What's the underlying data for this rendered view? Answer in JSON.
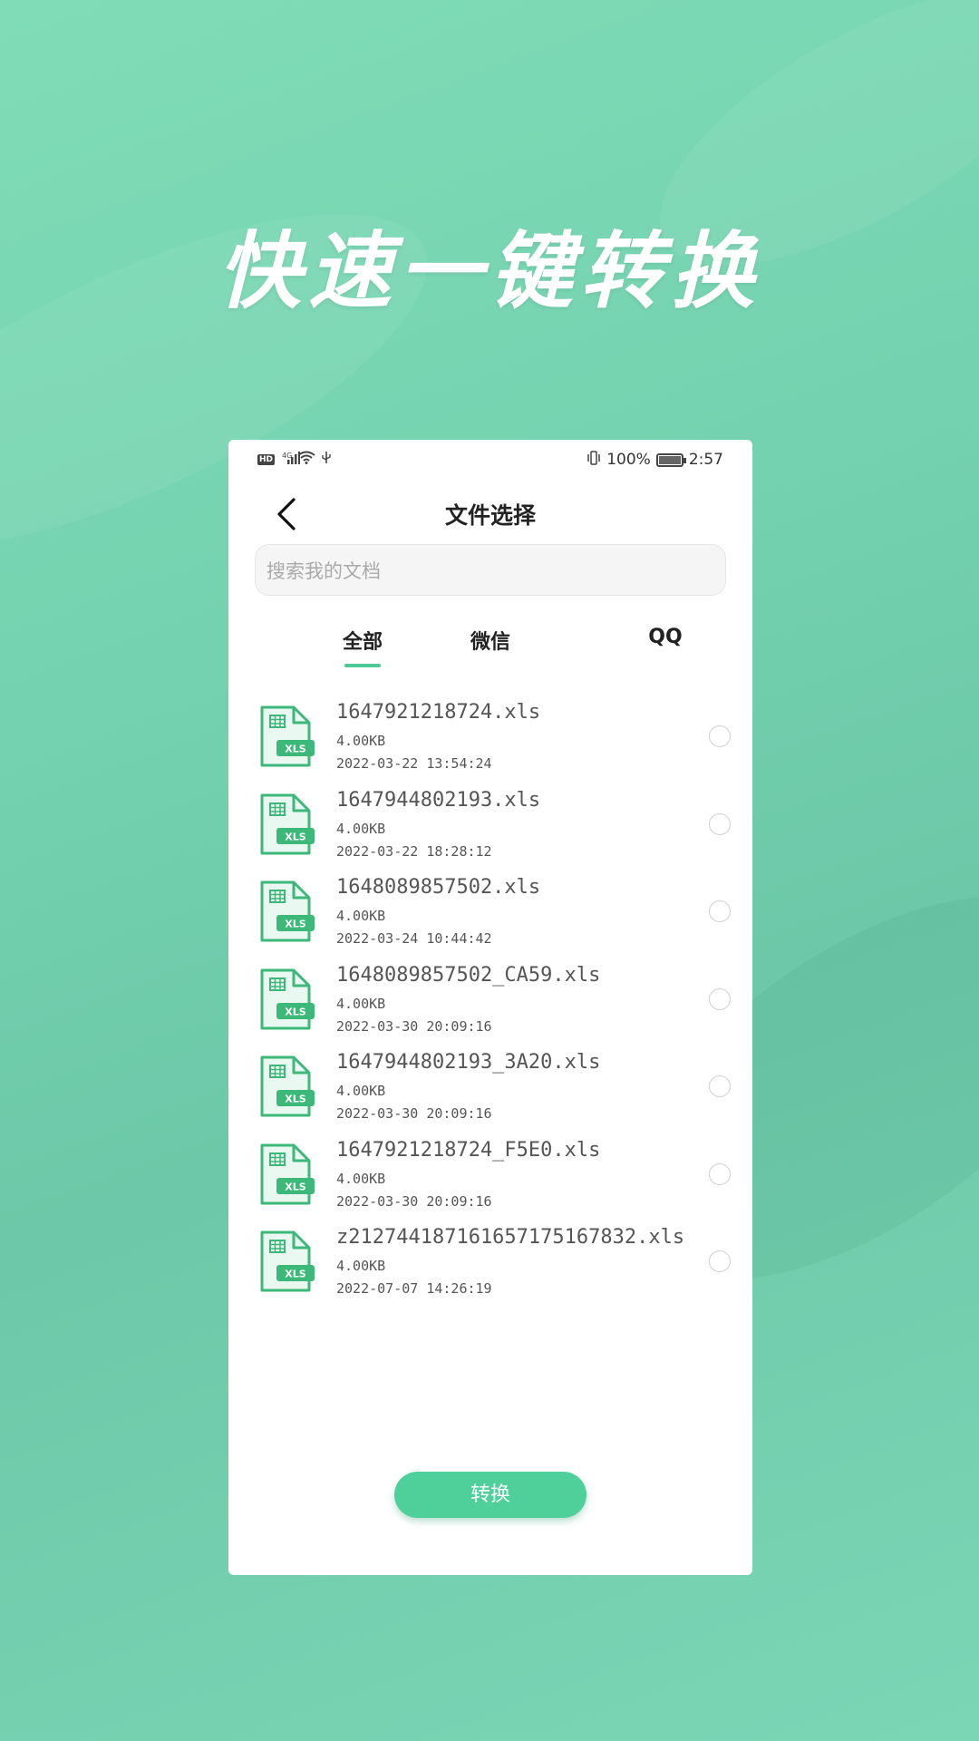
{
  "headline": "快速一键转换",
  "status_bar": {
    "left_icons": [
      "hd-icon",
      "signal-icon",
      "wifi-icon",
      "usb-icon"
    ],
    "hd_label": "HD",
    "network_label": "4G",
    "battery_percent": "100%",
    "time": "2:57"
  },
  "nav": {
    "title": "文件选择"
  },
  "search": {
    "placeholder": "搜索我的文档"
  },
  "tabs": [
    {
      "label": "全部",
      "active": true
    },
    {
      "label": "微信",
      "active": false
    },
    {
      "label": "QQ",
      "active": false
    }
  ],
  "files": [
    {
      "name": "1647921218724.xls",
      "size": "4.00KB",
      "date": "2022-03-22 13:54:24"
    },
    {
      "name": "1647944802193.xls",
      "size": "4.00KB",
      "date": "2022-03-22 18:28:12"
    },
    {
      "name": "1648089857502.xls",
      "size": "4.00KB",
      "date": "2022-03-24 10:44:42"
    },
    {
      "name": "1648089857502_CA59.xls",
      "size": "4.00KB",
      "date": "2022-03-30 20:09:16"
    },
    {
      "name": "1647944802193_3A20.xls",
      "size": "4.00KB",
      "date": "2022-03-30 20:09:16"
    },
    {
      "name": "1647921218724_F5E0.xls",
      "size": "4.00KB",
      "date": "2022-03-30 20:09:16"
    },
    {
      "name": "z21274418716165717516783２.xls",
      "size": "4.00KB",
      "date": "2022-07-07 14:26:19"
    }
  ],
  "file_icon_label": "XLS",
  "convert_button": "转换",
  "colors": {
    "accent": "#4fcf99",
    "background": "#74d2b0",
    "icon_green": "#3cb878"
  }
}
